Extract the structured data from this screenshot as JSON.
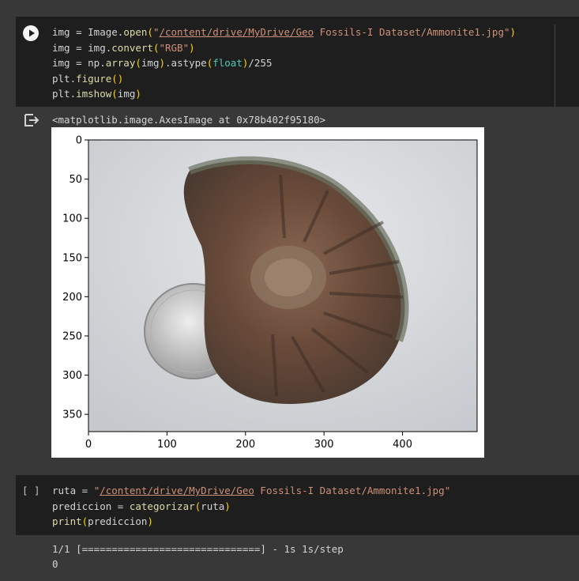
{
  "cell1": {
    "lines": [
      [
        "img = Image.",
        "open",
        "(",
        "\"",
        "/content/drive/MyDrive/Geo",
        " Fossils-I Dataset/Ammonite1.jpg\"",
        ")"
      ],
      [
        "img = img.",
        "convert",
        "(",
        "\"RGB\"",
        ")"
      ],
      [
        "img = np.",
        "array",
        "(",
        "img",
        ")",
        ".astype",
        "(",
        "float",
        ")",
        "/255"
      ],
      [
        "plt.",
        "figure",
        "()"
      ],
      [
        "plt.",
        "imshow",
        "(",
        "img",
        ")"
      ]
    ]
  },
  "output1": {
    "text": "<matplotlib.image.AxesImage at 0x78b402f95180>"
  },
  "plot": {
    "yticks": [
      "0",
      "50",
      "100",
      "150",
      "200",
      "250",
      "300",
      "350"
    ],
    "xticks": [
      "0",
      "100",
      "200",
      "300",
      "400"
    ]
  },
  "cell2": {
    "bracket": "[ ]",
    "line1_a": "ruta = ",
    "line1_q": "\"",
    "line1_link": "/content/drive/MyDrive/Geo",
    "line1_rest": " Fossils-I Dataset/Ammonite1.jpg\"",
    "line2_a": "prediccion = ",
    "line2_fn": "categorizar",
    "line2_p1": "(",
    "line2_arg": "ruta",
    "line2_p2": ")",
    "line3_fn": "print",
    "line3_p1": "(",
    "line3_arg": "prediccion",
    "line3_p2": ")"
  },
  "output2": {
    "line1": "1/1 [==============================] - 1s 1s/step",
    "line2": "0"
  }
}
